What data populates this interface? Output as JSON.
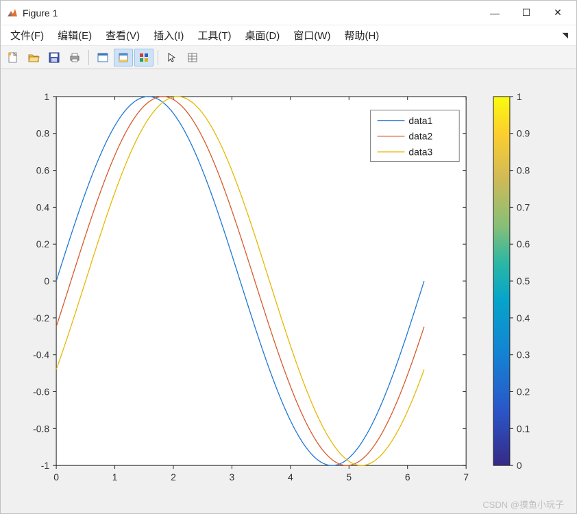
{
  "window": {
    "title": "Figure 1",
    "minimize": "—",
    "maximize": "☐",
    "close": "✕"
  },
  "menu": {
    "items": [
      "文件(F)",
      "编辑(E)",
      "查看(V)",
      "插入(I)",
      "工具(T)",
      "桌面(D)",
      "窗口(W)",
      "帮助(H)"
    ]
  },
  "toolbar": {
    "icons": [
      "new",
      "open",
      "save",
      "print",
      "sep",
      "newfig",
      "link",
      "panel",
      "sep",
      "pointer",
      "inspector"
    ],
    "active": [
      "link",
      "panel"
    ]
  },
  "legend": {
    "items": [
      "data1",
      "data2",
      "data3"
    ]
  },
  "colorbar": {
    "ticks": [
      "0",
      "0.1",
      "0.2",
      "0.3",
      "0.4",
      "0.5",
      "0.6",
      "0.7",
      "0.8",
      "0.9",
      "1"
    ]
  },
  "axes": {
    "xticks": [
      "0",
      "1",
      "2",
      "3",
      "4",
      "5",
      "6",
      "7"
    ],
    "yticks": [
      "-1",
      "-0.8",
      "-0.6",
      "-0.4",
      "-0.2",
      "0",
      "0.2",
      "0.4",
      "0.6",
      "0.8",
      "1"
    ]
  },
  "series_colors": [
    "#1f77d4",
    "#d65a2a",
    "#e6b800"
  ],
  "watermark": "CSDN @摸鱼小玩子",
  "chart_data": {
    "type": "line",
    "x_range": [
      0,
      6.283
    ],
    "y_range": [
      -1,
      1
    ],
    "xlim": [
      0,
      7
    ],
    "ylim": [
      -1,
      1
    ],
    "series": [
      {
        "name": "data1",
        "function": "sin(x)",
        "phase": 0.0
      },
      {
        "name": "data2",
        "function": "sin(x - 0.25)",
        "phase": 0.25
      },
      {
        "name": "data3",
        "function": "sin(x - 0.5)",
        "phase": 0.5
      }
    ],
    "colorbar": {
      "range": [
        0,
        1
      ],
      "cmap": "parula"
    }
  }
}
